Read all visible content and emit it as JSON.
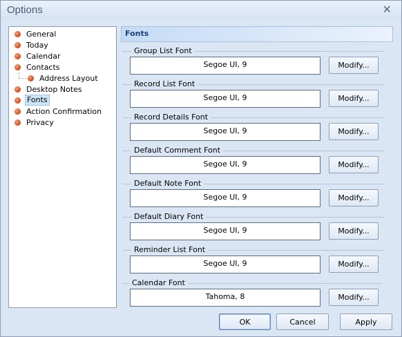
{
  "window": {
    "title": "Options",
    "close_glyph": "✕"
  },
  "tree": {
    "items": [
      {
        "label": "General"
      },
      {
        "label": "Today"
      },
      {
        "label": "Calendar"
      },
      {
        "label": "Contacts"
      },
      {
        "label": "Address Layout"
      },
      {
        "label": "Desktop Notes"
      },
      {
        "label": "Fonts",
        "selected": true
      },
      {
        "label": "Action Confirmation"
      },
      {
        "label": "Privacy"
      }
    ]
  },
  "panel": {
    "title": "Fonts"
  },
  "fonts": [
    {
      "label": "Group List Font",
      "value": "Segoe UI, 9",
      "button": "Modify..."
    },
    {
      "label": "Record List Font",
      "value": "Segoe UI, 9",
      "button": "Modify..."
    },
    {
      "label": "Record Details Font",
      "value": "Segoe UI, 9",
      "button": "Modify..."
    },
    {
      "label": "Default Comment Font",
      "value": "Segoe UI, 9",
      "button": "Modify..."
    },
    {
      "label": "Default Note Font",
      "value": "Segoe UI, 9",
      "button": "Modify..."
    },
    {
      "label": "Default Diary Font",
      "value": "Segoe UI, 9",
      "button": "Modify..."
    },
    {
      "label": "Reminder List Font",
      "value": "Segoe UI, 9",
      "button": "Modify..."
    },
    {
      "label": "Calendar Font",
      "value": "Tahoma, 8",
      "button": "Modify..."
    }
  ],
  "footer": {
    "ok": "OK",
    "cancel": "Cancel",
    "apply": "Apply"
  },
  "colors": {
    "accent": "#1f3f74",
    "bullet": "#d6541e",
    "selection": "#cde6f7"
  }
}
